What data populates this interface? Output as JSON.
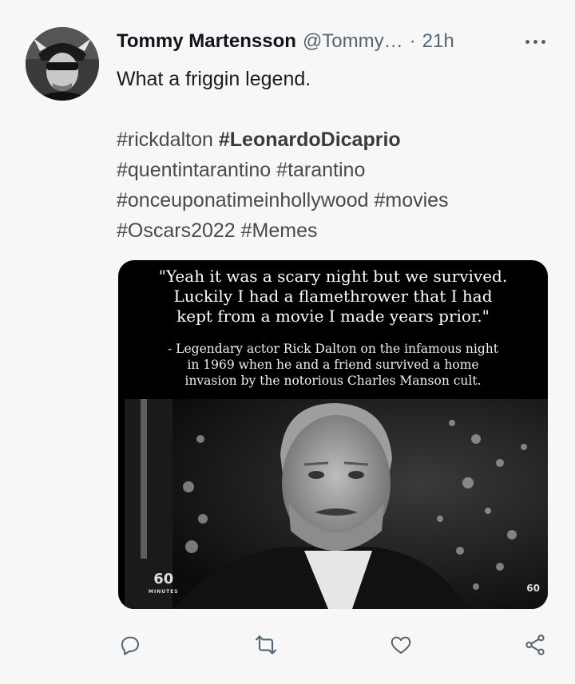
{
  "author": {
    "name": "Tommy Martensson",
    "handle": "@Tommy…",
    "separator": "·",
    "time": "21h"
  },
  "tweet": {
    "text": "What a friggin legend.",
    "hashtag_lines": [
      [
        {
          "text": "#rickdalton",
          "bold": false
        },
        {
          "text": "#LeonardoDicaprio",
          "bold": true
        }
      ],
      [
        {
          "text": "#quentintarantino",
          "bold": false
        },
        {
          "text": "#tarantino",
          "bold": false
        }
      ],
      [
        {
          "text": "#onceuponatimeinhollywood",
          "bold": false
        },
        {
          "text": "#movies",
          "bold": false
        }
      ],
      [
        {
          "text": "#Oscars2022",
          "bold": false
        },
        {
          "text": "#Memes",
          "bold": false
        }
      ]
    ]
  },
  "media": {
    "quote_lines": [
      "\"Yeah it was a scary night but we survived.",
      "Luckily I had a flamethrower that I had",
      "kept from a movie I made years prior.\""
    ],
    "attribution_lines": [
      "- Legendary actor Rick Dalton on the infamous night",
      "in 1969 when he and a friend survived a home",
      "invasion by the notorious Charles Manson cult."
    ],
    "logo_left": "60",
    "logo_left_sub": "MINUTES",
    "logo_right": "60"
  },
  "icons": {
    "more": "more-horizontal-icon",
    "reply": "reply-icon",
    "retweet": "retweet-icon",
    "like": "like-icon",
    "share": "share-icon"
  },
  "colors": {
    "background": "#f7f7f7",
    "secondary_text": "#536471",
    "icon": "#536471"
  }
}
